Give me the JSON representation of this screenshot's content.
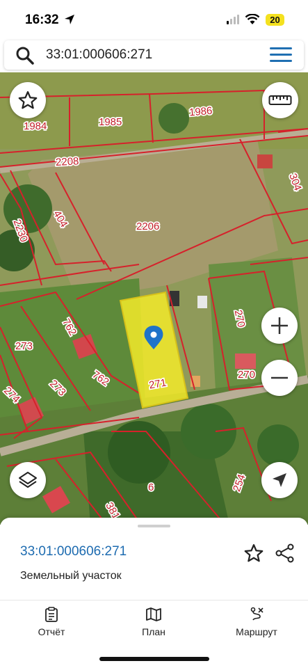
{
  "status_bar": {
    "time": "16:32",
    "battery": "20"
  },
  "search": {
    "query": "33:01:000606:271"
  },
  "map": {
    "parcel_labels": [
      "1984",
      "1985",
      "1986",
      "2208",
      "304",
      "2230",
      "404",
      "2206",
      "762",
      "273",
      "273",
      "762",
      "270",
      "270",
      "274",
      "271",
      "6",
      "254",
      "381"
    ],
    "highlighted_parcel_label": "271",
    "highlight_color": "#f3ea2a",
    "boundary_color": "#d6212b"
  },
  "bottom_sheet": {
    "cadastral_number": "33:01:000606:271",
    "parcel_type": "Земельный участок"
  },
  "tabs": [
    {
      "label": "Отчёт",
      "icon": "report-icon"
    },
    {
      "label": "План",
      "icon": "map-icon"
    },
    {
      "label": "Маршрут",
      "icon": "route-icon"
    }
  ],
  "colors": {
    "accent": "#1f6fb2"
  }
}
